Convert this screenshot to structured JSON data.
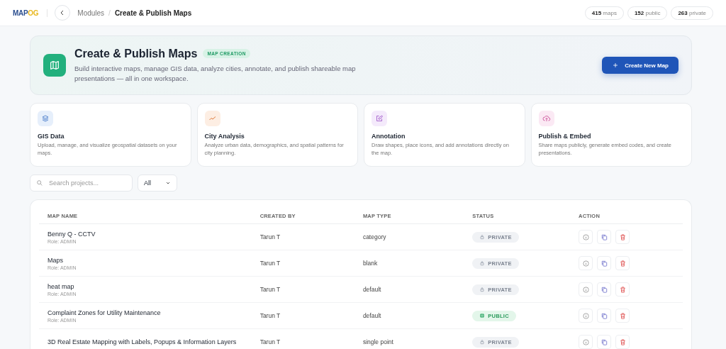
{
  "header": {
    "logo": {
      "text": "MAP",
      "accent": "OG"
    },
    "breadcrumb_separator": "/",
    "breadcrumb": [
      {
        "label": "Modules",
        "current": false
      },
      {
        "label": "Create & Publish Maps",
        "current": true
      }
    ],
    "stats": [
      {
        "value": "415",
        "label": "maps"
      },
      {
        "value": "152",
        "label": "public"
      },
      {
        "value": "263",
        "label": "private"
      }
    ]
  },
  "hero": {
    "title": "Create & Publish Maps",
    "badge": "MAP CREATION",
    "description": "Build interactive maps, manage GIS data, analyze cities, annotate, and publish shareable map presentations — all in one workspace.",
    "button": "Create New Map"
  },
  "features": [
    {
      "kind": "layers",
      "title": "GIS Data",
      "description": "Upload, manage, and visualize geospatial datasets on your maps.",
      "color": "#e6effb"
    },
    {
      "kind": "trend",
      "title": "City Analysis",
      "description": "Analyze urban data, demographics, and spatial patterns for city planning.",
      "color": "#fdeee3"
    },
    {
      "kind": "edit",
      "title": "Annotation",
      "description": "Draw shapes, place icons, and add annotations directly on the map.",
      "color": "#f4eafb"
    },
    {
      "kind": "upload",
      "title": "Publish & Embed",
      "description": "Share maps publicly, generate embed codes, and create presentations.",
      "color": "#fbe9f4"
    }
  ],
  "filters": {
    "search_placeholder": "Search projects...",
    "type_filter": "All"
  },
  "table": {
    "columns": [
      "MAP NAME",
      "CREATED BY",
      "MAP TYPE",
      "STATUS",
      "ACTION"
    ],
    "rows": [
      {
        "name": "Benny Q - CCTV",
        "role": "Role: ADMIN",
        "created_by": "Tarun T",
        "map_type": "category",
        "status": {
          "kind": "private",
          "label": "PRIVATE"
        }
      },
      {
        "name": "Maps",
        "role": "Role: ADMIN",
        "created_by": "Tarun T",
        "map_type": "blank",
        "status": {
          "kind": "private",
          "label": "PRIVATE"
        }
      },
      {
        "name": "heat map",
        "role": "Role: ADMIN",
        "created_by": "Tarun T",
        "map_type": "default",
        "status": {
          "kind": "private",
          "label": "PRIVATE"
        }
      },
      {
        "name": "Complaint Zones for Utility Maintenance",
        "role": "Role: ADMIN",
        "created_by": "Tarun T",
        "map_type": "default",
        "status": {
          "kind": "public",
          "label": "PUBLIC"
        }
      },
      {
        "name": "3D Real Estate Mapping with Labels, Popups & Information Layers",
        "created_by": "Tarun T",
        "map_type": "single point",
        "status": {
          "kind": "private",
          "label": "PRIVATE"
        }
      }
    ]
  }
}
